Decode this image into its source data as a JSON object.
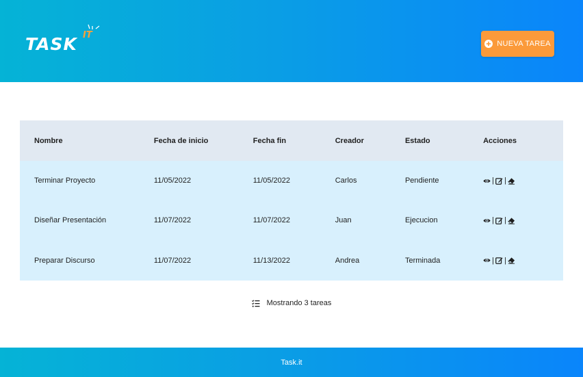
{
  "header": {
    "logo_text": "TASK",
    "logo_sup": "IT",
    "new_button_label": "NUEVA TAREA"
  },
  "table": {
    "columns": [
      "Nombre",
      "Fecha de inicio",
      "Fecha fin",
      "Creador",
      "Estado",
      "Acciones"
    ],
    "rows": [
      {
        "nombre": "Terminar Proyecto",
        "inicio": "11/05/2022",
        "fin": "11/05/2022",
        "creador": "Carlos",
        "estado": "Pendiente"
      },
      {
        "nombre": "Diseñar Presentación",
        "inicio": "11/07/2022",
        "fin": "11/07/2022",
        "creador": "Juan",
        "estado": "Ejecucion"
      },
      {
        "nombre": "Preparar Discurso",
        "inicio": "11/07/2022",
        "fin": "11/13/2022",
        "creador": "Andrea",
        "estado": "Terminada"
      }
    ],
    "action_separator": "|"
  },
  "summary": {
    "text": "Mostrando 3 tareas"
  },
  "footer": {
    "text": "Task.it"
  },
  "icons": {
    "add": "plus-circle-icon",
    "view": "eye-icon",
    "edit": "edit-icon",
    "delete": "eraser-icon",
    "summary": "checklist-icon"
  },
  "colors": {
    "gradient_start": "#05b3d6",
    "gradient_end": "#0a85fb",
    "accent": "#fb9a3a",
    "table_header": "#e1e9f2",
    "table_row": "#d8f0fd"
  }
}
